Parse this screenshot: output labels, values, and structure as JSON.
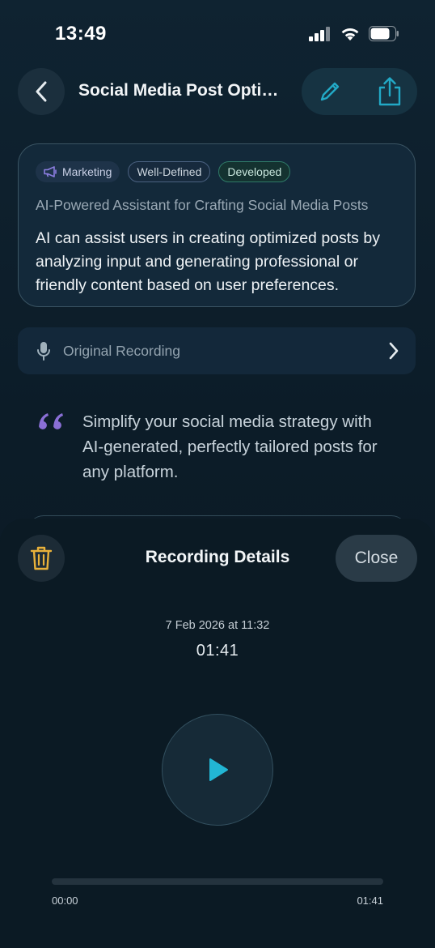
{
  "status_bar": {
    "time": "13:49",
    "icons": [
      "cellular-signal-icon",
      "wifi-icon",
      "battery-icon"
    ]
  },
  "header": {
    "title": "Social Media Post Optimizer",
    "back_icon": "chevron-left-icon",
    "edit_icon": "pencil-icon",
    "share_icon": "share-icon"
  },
  "idea_card": {
    "tags": [
      {
        "label": "Marketing",
        "icon": "megaphone-icon"
      },
      {
        "label": "Well-Defined"
      },
      {
        "label": "Developed"
      }
    ],
    "subtitle": "AI-Powered Assistant for Crafting Social Media Posts",
    "body": "AI can assist users in creating optimized posts by analyzing input and generating professional or friendly content based on user preferences."
  },
  "original_recording": {
    "label": "Original Recording",
    "icon": "microphone-icon"
  },
  "quote": {
    "text": "Simplify your social media strategy with AI-generated, perfectly tailored posts for any platform."
  },
  "sheet": {
    "title": "Recording Details",
    "close_label": "Close",
    "delete_icon": "trash-icon",
    "date": "7 Feb 2026 at 11:32",
    "duration": "01:41",
    "play_icon": "play-icon",
    "progress": 0.0,
    "time_start": "00:00",
    "time_end": "01:41"
  },
  "colors": {
    "accent": "#22b6d4",
    "trash": "#e8b13a",
    "quote_mark": "#8a6fd6",
    "tag_developed": "#2f7a68"
  }
}
